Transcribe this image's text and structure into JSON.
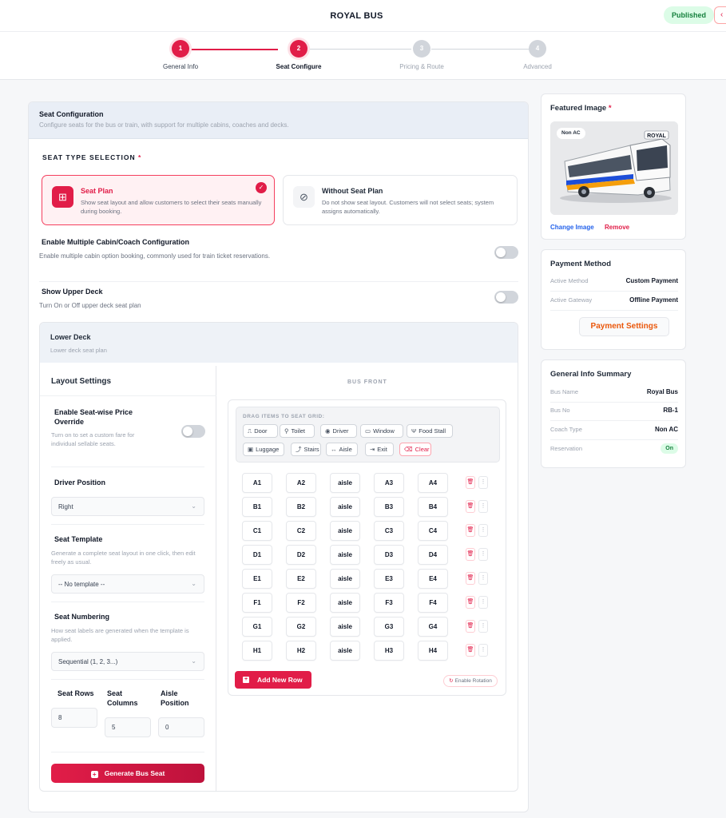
{
  "header": {
    "title": "ROYAL BUS",
    "status_badge": "Published",
    "back_icon": "‹"
  },
  "steps": [
    {
      "num": "1",
      "label": "General Info"
    },
    {
      "num": "2",
      "label": "Seat Configure"
    },
    {
      "num": "3",
      "label": "Pricing & Route"
    },
    {
      "num": "4",
      "label": "Advanced"
    }
  ],
  "seat_config": {
    "title": "Seat Configuration",
    "subtitle": "Configure seats for the bus or train, with support for multiple cabins, coaches and decks.",
    "type_label": "SEAT TYPE SELECTION",
    "req": "*",
    "options": [
      {
        "title": "Seat Plan",
        "desc": "Show seat layout and allow customers to select their seats manually during booking.",
        "icon": "⊞",
        "check": "✓"
      },
      {
        "title": "Without Seat Plan",
        "desc": "Do not show seat layout. Customers will not select seats; system assigns automatically.",
        "icon": "⊘"
      }
    ],
    "multi_cabin": {
      "title": "Enable Multiple Cabin/Coach Configuration",
      "desc": "Enable multiple cabin option booking, commonly used for train ticket reservations."
    },
    "upper_deck": {
      "title": "Show Upper Deck",
      "desc": "Turn On or Off upper deck seat plan"
    }
  },
  "deck": {
    "title": "Lower Deck",
    "subtitle": "Lower deck seat plan"
  },
  "layout": {
    "title": "Layout Settings",
    "override_title": "Enable Seat-wise Price Override",
    "override_desc": "Turn on to set a custom fare for individual sellable seats.",
    "driver_label": "Driver Position",
    "driver_value": "Right",
    "template_label": "Seat Template",
    "template_desc": "Generate a complete seat layout in one click, then edit freely as usual.",
    "template_value": "-- No template --",
    "numbering_label": "Seat Numbering",
    "numbering_desc": "How seat labels are generated when the template is applied.",
    "numbering_value": "Sequential (1, 2, 3...)",
    "rows_label": "Seat Rows",
    "rows_value": "8",
    "cols_label": "Seat Columns",
    "cols_value": "5",
    "aisle_label": "Aisle Position",
    "aisle_value": "0",
    "generate_label": "Generate Bus Seat",
    "generate_icon": "+",
    "chevron": "⌄"
  },
  "grid": {
    "bus_front": "BUS FRONT",
    "palette_title": "DRAG ITEMS TO SEAT GRID:",
    "palette": [
      {
        "icon": "⎍",
        "label": "Door"
      },
      {
        "icon": "⚲",
        "label": "Toilet"
      },
      {
        "icon": "◉",
        "label": "Driver"
      },
      {
        "icon": "▭",
        "label": "Window"
      },
      {
        "icon": "Ψ",
        "label": "Food Stall"
      },
      {
        "icon": "▣",
        "label": "Luggage"
      },
      {
        "icon": "⤴",
        "label": "Stairs"
      },
      {
        "icon": "↔",
        "label": "Aisle"
      },
      {
        "icon": "⇥",
        "label": "Exit"
      },
      {
        "icon": "⌫",
        "label": "Clear"
      }
    ],
    "rows": [
      [
        "A1",
        "A2",
        "aisle",
        "A3",
        "A4"
      ],
      [
        "B1",
        "B2",
        "aisle",
        "B3",
        "B4"
      ],
      [
        "C1",
        "C2",
        "aisle",
        "C3",
        "C4"
      ],
      [
        "D1",
        "D2",
        "aisle",
        "D3",
        "D4"
      ],
      [
        "E1",
        "E2",
        "aisle",
        "E3",
        "E4"
      ],
      [
        "F1",
        "F2",
        "aisle",
        "F3",
        "F4"
      ],
      [
        "G1",
        "G2",
        "aisle",
        "G3",
        "G4"
      ],
      [
        "H1",
        "H2",
        "aisle",
        "H3",
        "H4"
      ]
    ],
    "delete_icon": "🗑",
    "drag_icon": "⋮",
    "add_row_label": "Add New Row",
    "add_row_icon": "+",
    "rotation_label": "Enable Rotation",
    "rotation_icon": "↻"
  },
  "featured": {
    "title": "Featured Image",
    "req": "*",
    "tag": "Non AC",
    "bus_text": "ROYAL",
    "change": "Change Image",
    "remove": "Remove"
  },
  "payment": {
    "title": "Payment Method",
    "rows": [
      {
        "k": "Active Method",
        "v": "Custom Payment"
      },
      {
        "k": "Active Gateway",
        "v": "Offline Payment"
      }
    ],
    "button": "Payment Settings"
  },
  "summary": {
    "title": "General Info Summary",
    "rows": [
      {
        "k": "Bus Name",
        "v": "Royal Bus"
      },
      {
        "k": "Bus No",
        "v": "RB-1"
      },
      {
        "k": "Coach Type",
        "v": "Non AC"
      },
      {
        "k": "Reservation",
        "v": "On"
      }
    ]
  },
  "colors": {
    "accent": "#e11d48",
    "success": "#15803d",
    "orange": "#ea580c"
  }
}
